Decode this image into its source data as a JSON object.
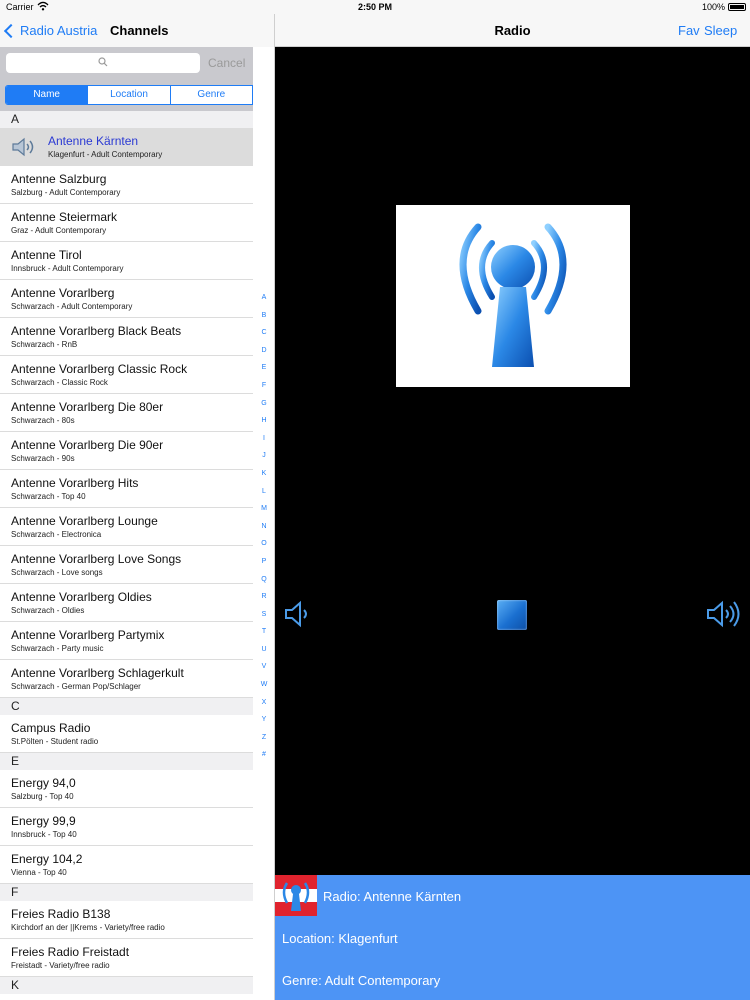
{
  "status": {
    "carrier": "Carrier",
    "time": "2:50 PM",
    "battery": "100%"
  },
  "master": {
    "back_label": "Radio Austria",
    "title": "Channels",
    "search": {
      "placeholder": "",
      "cancel_label": "Cancel"
    },
    "segments": [
      {
        "label": "Name",
        "active": true
      },
      {
        "label": "Location",
        "active": false
      },
      {
        "label": "Genre",
        "active": false
      }
    ],
    "sections": [
      {
        "letter": "A",
        "rows": [
          {
            "name": "Antenne Kärnten",
            "sub": "Klagenfurt - Adult Contemporary",
            "selected": true
          },
          {
            "name": "Antenne Salzburg",
            "sub": "Salzburg - Adult Contemporary"
          },
          {
            "name": "Antenne Steiermark",
            "sub": "Graz - Adult Contemporary"
          },
          {
            "name": "Antenne Tirol",
            "sub": "Innsbruck - Adult Contemporary"
          },
          {
            "name": "Antenne Vorarlberg",
            "sub": "Schwarzach - Adult Contemporary"
          },
          {
            "name": "Antenne Vorarlberg Black Beats",
            "sub": "Schwarzach - RnB"
          },
          {
            "name": "Antenne Vorarlberg Classic Rock",
            "sub": "Schwarzach - Classic Rock"
          },
          {
            "name": "Antenne Vorarlberg Die 80er",
            "sub": "Schwarzach - 80s"
          },
          {
            "name": "Antenne Vorarlberg Die 90er",
            "sub": "Schwarzach - 90s"
          },
          {
            "name": "Antenne Vorarlberg Hits",
            "sub": "Schwarzach - Top 40"
          },
          {
            "name": "Antenne Vorarlberg Lounge",
            "sub": "Schwarzach - Electronica"
          },
          {
            "name": "Antenne Vorarlberg Love Songs",
            "sub": "Schwarzach - Love songs"
          },
          {
            "name": "Antenne Vorarlberg Oldies",
            "sub": "Schwarzach - Oldies"
          },
          {
            "name": "Antenne Vorarlberg Partymix",
            "sub": "Schwarzach - Party music"
          },
          {
            "name": "Antenne Vorarlberg Schlagerkult",
            "sub": "Schwarzach - German Pop/Schlager"
          }
        ]
      },
      {
        "letter": "C",
        "rows": [
          {
            "name": "Campus Radio",
            "sub": "St.Pölten - Student radio"
          }
        ]
      },
      {
        "letter": "E",
        "rows": [
          {
            "name": "Energy 94,0",
            "sub": "Salzburg - Top 40"
          },
          {
            "name": "Energy 99,9",
            "sub": "Innsbruck - Top 40"
          },
          {
            "name": "Energy 104,2",
            "sub": "Vienna - Top 40"
          }
        ]
      },
      {
        "letter": "F",
        "rows": [
          {
            "name": "Freies Radio B138",
            "sub": "Kirchdorf an der ||Krems - Variety/free radio"
          },
          {
            "name": "Freies Radio Freistadt",
            "sub": "Freistadt - Variety/free radio"
          }
        ]
      },
      {
        "letter": "K",
        "rows": []
      }
    ],
    "index": [
      "A",
      "B",
      "C",
      "D",
      "E",
      "F",
      "G",
      "H",
      "I",
      "J",
      "K",
      "L",
      "M",
      "N",
      "O",
      "P",
      "Q",
      "R",
      "S",
      "T",
      "U",
      "V",
      "W",
      "X",
      "Y",
      "Z",
      "#"
    ]
  },
  "detail": {
    "title": "Radio",
    "fav_label": "Fav",
    "sleep_label": "Sleep",
    "info": {
      "radio": "Radio: Antenne Kärnten",
      "location": "Location: Klagenfurt",
      "genre": "Genre: Adult Contemporary"
    }
  },
  "colors": {
    "accent": "#1f7cf5",
    "info_panel": "#4d94f5",
    "player_bg": "#000000"
  },
  "icons": {
    "back": "chevron-left-icon",
    "search": "search-icon",
    "now_playing": "speaker-icon",
    "artwork": "radio-tower-icon",
    "volume_down": "volume-down-icon",
    "stop": "stop-icon",
    "volume_up": "volume-up-icon",
    "flag": "austria-flag-logo"
  }
}
